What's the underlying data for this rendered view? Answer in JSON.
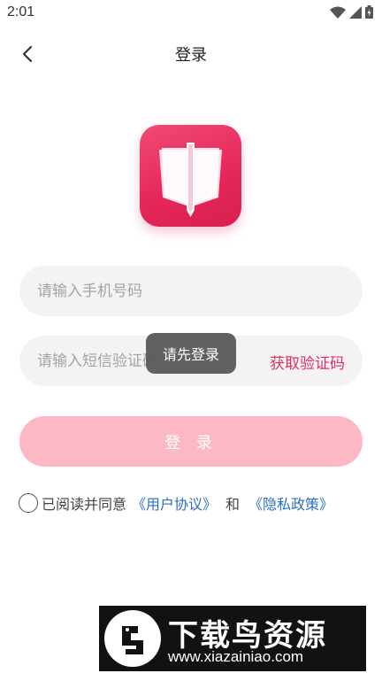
{
  "status_bar": {
    "time": "2:01",
    "icons": [
      "wifi-icon",
      "signal-icon",
      "battery-icon"
    ]
  },
  "nav": {
    "title": "登录",
    "back_icon": "chevron-left-icon"
  },
  "logo": {
    "icon": "open-book-icon",
    "color": "#e42659"
  },
  "form": {
    "phone_placeholder": "请输入手机号码",
    "code_placeholder": "请输入短信验证码",
    "get_code_label": "获取验证码"
  },
  "login_button": {
    "label": "登 录",
    "color": "#fdb8c6"
  },
  "agreement": {
    "prefix": "已阅读并同意",
    "user_agreement": "《用户协议》",
    "and": "和",
    "privacy_policy": "《隐私政策》",
    "link_color": "#2b6fc4"
  },
  "toast": {
    "message": "请先登录"
  },
  "watermark": {
    "title": "下载鸟资源",
    "url": "www.xiazainiao.com"
  }
}
